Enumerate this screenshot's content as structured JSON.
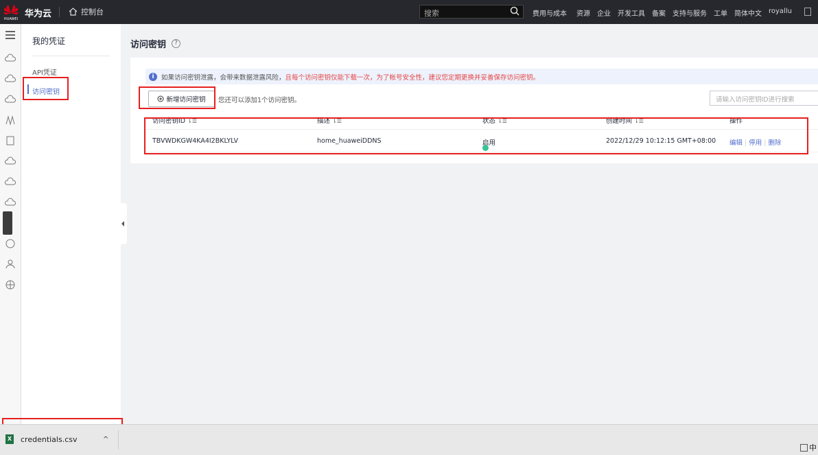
{
  "topbar": {
    "brand": "华为云",
    "logo_text": "HUAWEI",
    "console": "控制台",
    "search_placeholder": "搜索",
    "links": [
      "费用与成本",
      "资源",
      "企业",
      "开发工具",
      "备案",
      "支持与服务",
      "工单",
      "简体中文",
      "royallu"
    ]
  },
  "menu": {
    "title": "我的凭证",
    "items": [
      "API凭证",
      "访问密钥"
    ],
    "active": "访问密钥"
  },
  "page": {
    "title": "访问密钥",
    "help": "?"
  },
  "notice": {
    "text": "如果访问密钥泄露，会带来数据泄露风险，",
    "warning": "且每个访问密钥仅能下载一次，为了帐号安全性，建议您定期更换并妥善保存访问密钥。"
  },
  "actions": {
    "add_button": "新增访问密钥",
    "add_hint": "您还可以添加1个访问密钥。",
    "search_placeholder": "请输入访问密钥ID进行搜索"
  },
  "table": {
    "headers": [
      "访问密钥ID",
      "描述",
      "状态",
      "创建时间",
      "操作"
    ],
    "rows": [
      {
        "id": "TBVWDKGW4KA4I2BKLYLV",
        "desc": "home_huaweiDDNS",
        "status": "启用",
        "created": "2022/12/29 10:12:15 GMT+08:00",
        "ops": [
          "编辑",
          "停用",
          "删除"
        ]
      }
    ]
  },
  "download": {
    "filename": "credentials.csv"
  },
  "tray": {
    "text": "中"
  },
  "colors": {
    "accent": "#526ecc",
    "warning": "#e54545",
    "highlight": "#e61e1e",
    "status_ok": "#3ac295"
  }
}
